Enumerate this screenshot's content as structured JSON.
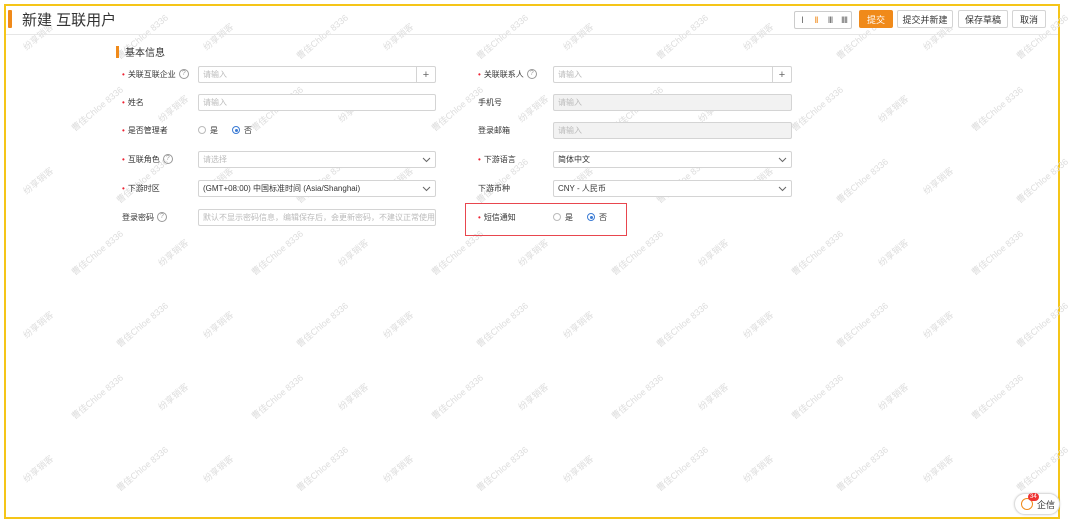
{
  "page": {
    "title": "新建 互联用户"
  },
  "view_toggle": {
    "one": "I",
    "two": "II",
    "three": "III",
    "four": "IIII"
  },
  "toolbar": {
    "submit": "提交",
    "submit_new": "提交并新建",
    "save_draft": "保存草稿",
    "cancel": "取消"
  },
  "section": {
    "title": "基本信息"
  },
  "form": {
    "company": {
      "label": "关联互联企业",
      "placeholder": "请输入"
    },
    "contact": {
      "label": "关联联系人",
      "placeholder": "请输入"
    },
    "name": {
      "label": "姓名",
      "placeholder": "请输入"
    },
    "phone": {
      "label": "手机号",
      "placeholder": "请输入"
    },
    "is_admin": {
      "label": "是否管理者",
      "yes": "是",
      "no": "否",
      "selected": "否"
    },
    "login_email": {
      "label": "登录邮箱",
      "placeholder": "请输入"
    },
    "role": {
      "label": "互联角色",
      "placeholder": "请选择"
    },
    "language": {
      "label": "下游语言",
      "value": "简体中文"
    },
    "timezone": {
      "label": "下游时区",
      "value": "(GMT+08:00) 中国标准时间 (Asia/Shanghai)"
    },
    "currency": {
      "label": "下游币种",
      "value": "CNY - 人民币"
    },
    "password": {
      "label": "登录密码",
      "placeholder": "默认不显示密码信息，编辑保存后，会更新密码，不建议正常使用的客户修改"
    },
    "sms": {
      "label": "短信通知",
      "yes": "是",
      "no": "否",
      "selected": "否"
    }
  },
  "watermarks": {
    "a": "纷享销客",
    "b": "曹佳Chloe 8336"
  },
  "help": {
    "label": "企信",
    "badge": "34"
  },
  "colors": {
    "accent": "#f08a1a",
    "highlight": "#e8464e",
    "frame": "#f5c518",
    "radio": "#3b7bd4"
  }
}
